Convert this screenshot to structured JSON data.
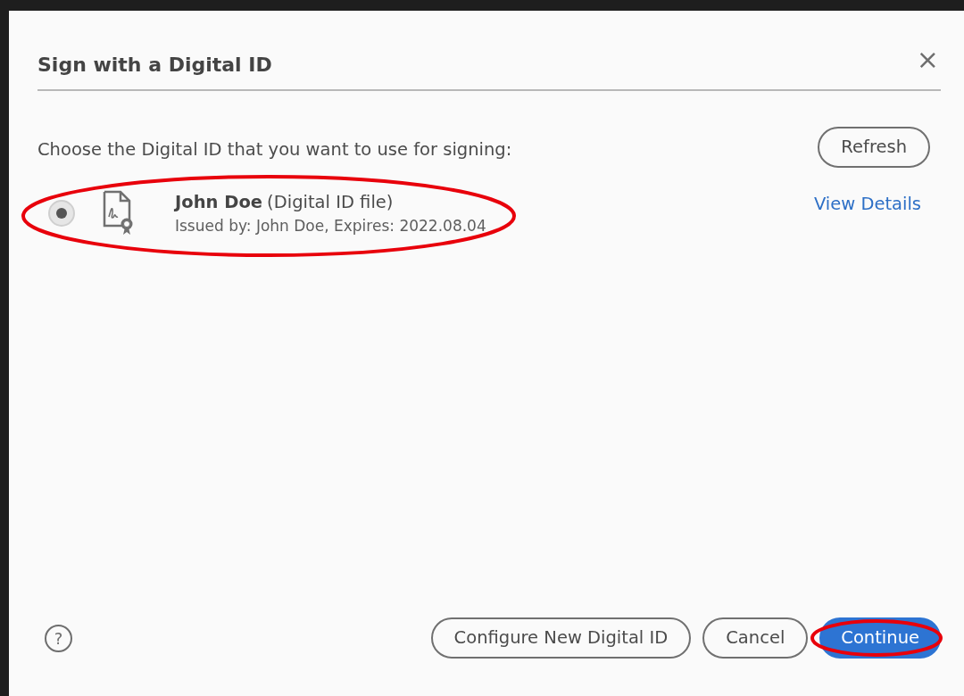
{
  "dialog": {
    "title": "Sign with a Digital ID",
    "close": "×"
  },
  "prompt": "Choose the Digital ID that you want to use for signing:",
  "refresh_button": "Refresh",
  "digital_ids": [
    {
      "name": "John Doe",
      "type": "(Digital ID file)",
      "details": "Issued by: John Doe, Expires: 2022.08.04",
      "selected": true,
      "circled": true,
      "link": "View Details"
    }
  ],
  "footer": {
    "help": "?",
    "buttons": [
      {
        "label": "Configure New Digital ID",
        "kind": "outline",
        "circled": false
      },
      {
        "label": "Cancel",
        "kind": "outline",
        "circled": false
      },
      {
        "label": "Continue",
        "kind": "primary",
        "circled": true
      }
    ]
  }
}
